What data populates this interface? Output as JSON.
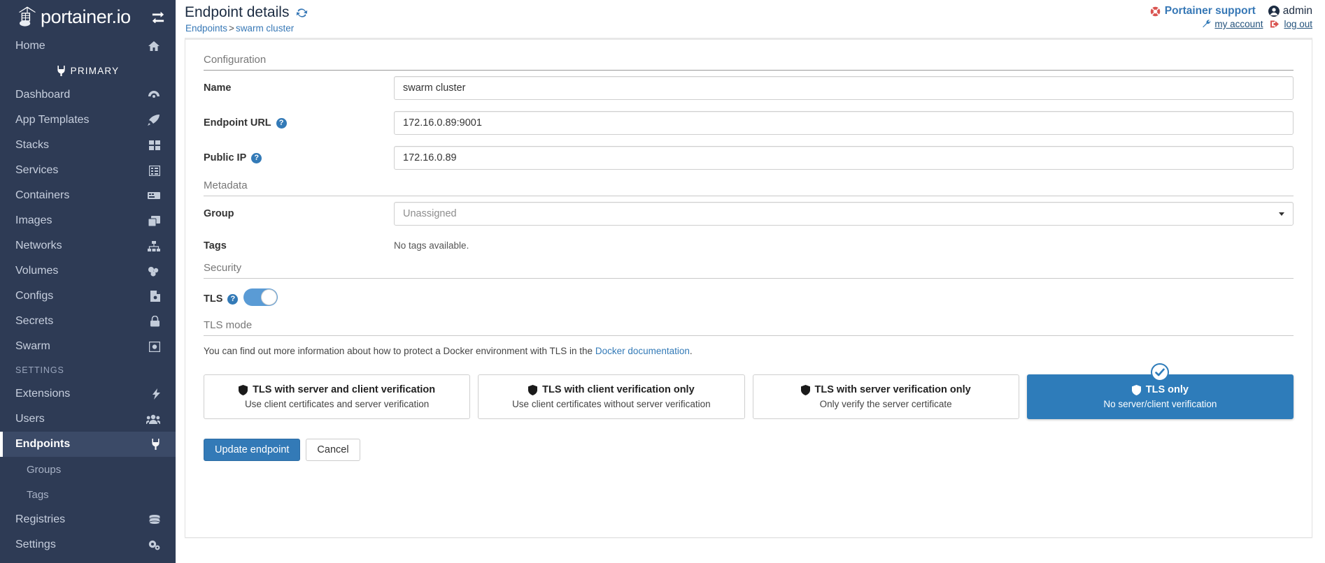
{
  "sidebar": {
    "brand": "portainer.io",
    "toggle_icon": "collapse-arrows-icon",
    "home": {
      "label": "Home",
      "icon": "home-icon"
    },
    "primary": {
      "label": "PRIMARY",
      "icon": "plug-icon"
    },
    "items": [
      {
        "label": "Dashboard",
        "icon": "dashboard-icon"
      },
      {
        "label": "App Templates",
        "icon": "rocket-icon"
      },
      {
        "label": "Stacks",
        "icon": "stacks-icon"
      },
      {
        "label": "Services",
        "icon": "services-icon"
      },
      {
        "label": "Containers",
        "icon": "containers-icon"
      },
      {
        "label": "Images",
        "icon": "images-icon"
      },
      {
        "label": "Networks",
        "icon": "networks-icon"
      },
      {
        "label": "Volumes",
        "icon": "volumes-icon"
      },
      {
        "label": "Configs",
        "icon": "configs-icon"
      },
      {
        "label": "Secrets",
        "icon": "secrets-icon"
      },
      {
        "label": "Swarm",
        "icon": "swarm-icon"
      }
    ],
    "settings_header": "SETTINGS",
    "settings_items": [
      {
        "label": "Extensions",
        "icon": "bolt-icon",
        "active": false
      },
      {
        "label": "Users",
        "icon": "users-icon",
        "active": false
      },
      {
        "label": "Endpoints",
        "icon": "plug-icon",
        "active": true
      },
      {
        "label": "Registries",
        "icon": "database-icon",
        "active": false
      },
      {
        "label": "Settings",
        "icon": "gears-icon",
        "active": false
      }
    ],
    "endpoints_sub": [
      {
        "label": "Groups"
      },
      {
        "label": "Tags"
      }
    ]
  },
  "header": {
    "title": "Endpoint details",
    "refresh_icon": "refresh-icon",
    "breadcrumb_root": "Endpoints",
    "breadcrumb_sep": ">",
    "breadcrumb_current": "swarm cluster",
    "support_label": "Portainer support",
    "support_icon": "lifebuoy-icon",
    "user_label": "admin",
    "user_icon": "user-circle-icon",
    "my_account_label": "my account",
    "my_account_icon": "wrench-icon",
    "logout_label": "log out",
    "logout_icon": "logout-icon"
  },
  "form": {
    "configuration_title": "Configuration",
    "name_label": "Name",
    "name_value": "swarm cluster",
    "endpoint_url_label": "Endpoint URL",
    "endpoint_url_value": "172.16.0.89:9001",
    "public_ip_label": "Public IP",
    "public_ip_value": "172.16.0.89",
    "metadata_title": "Metadata",
    "group_label": "Group",
    "group_value": "Unassigned",
    "tags_label": "Tags",
    "tags_value": "No tags available.",
    "security_title": "Security",
    "tls_label": "TLS",
    "tls_enabled": true,
    "tls_mode_title": "TLS mode",
    "doc_text_before": "You can find out more information about how to protect a Docker environment with TLS in the ",
    "doc_link": "Docker documentation",
    "doc_text_after": ".",
    "help_glyph": "?"
  },
  "tls_modes": [
    {
      "title": "TLS with server and client verification",
      "desc": "Use client certificates and server verification",
      "icon": "shield-icon",
      "selected": false
    },
    {
      "title": "TLS with client verification only",
      "desc": "Use client certificates without server verification",
      "icon": "shield-icon",
      "selected": false
    },
    {
      "title": "TLS with server verification only",
      "desc": "Only verify the server certificate",
      "icon": "shield-icon",
      "selected": false
    },
    {
      "title": "TLS only",
      "desc": "No server/client verification",
      "icon": "shield-icon",
      "selected": true,
      "badge_icon": "check-circle-icon"
    }
  ],
  "actions": {
    "update_label": "Update endpoint",
    "cancel_label": "Cancel"
  },
  "colors": {
    "sidebar_bg": "#2e3b55",
    "sidebar_active_bg": "#3b4a67",
    "accent_blue": "#337ab7",
    "selected_card": "#2e7cba",
    "link_blue": "#3778b6",
    "support_red": "#d9534f"
  }
}
